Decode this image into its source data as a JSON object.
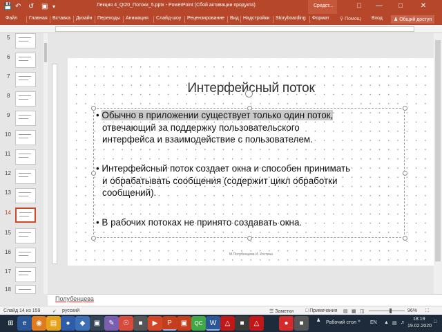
{
  "titlebar": {
    "title": "Лекция 4_Qt20_Потоки_5.pptx - PowerPoint (Сбой активации продукта)",
    "tools_tab": "Средст..."
  },
  "ribbon": {
    "tabs": [
      "Файл",
      "Главная",
      "Вставка",
      "Дизайн",
      "Переходы",
      "Анимация",
      "Слайд-шоу",
      "Рецензирование",
      "Вид",
      "Надстройки",
      "Storyboarding",
      "Формат"
    ],
    "tell_me": "Помощ",
    "signin": "Вход",
    "share": "Общий доступ"
  },
  "thumbnails": {
    "numbers": [
      "5",
      "6",
      "7",
      "8",
      "9",
      "10",
      "11",
      "12",
      "13",
      "14",
      "15",
      "16",
      "17",
      "18"
    ],
    "active": "14"
  },
  "slide": {
    "title": "Интерфейсный поток",
    "bullets": [
      {
        "lines": [
          "Обычно в приложении существует только один поток,",
          "отвечающий за поддержку пользовательского",
          "интерфейса и взаимодействие с пользователем."
        ]
      },
      {
        "lines": [
          "Интерфейсный поток создает окна и способен принимать",
          "и обрабатывать сообщения (содержит цикл обработки",
          "сообщений)."
        ]
      },
      {
        "lines": [
          "В рабочих потоках не принято создавать окна."
        ]
      }
    ],
    "footer": "М.Полубенцева И. Костина"
  },
  "notes": {
    "text": "Полубенцева"
  },
  "statusbar": {
    "slide_info": "Слайд 14 из 159",
    "language": "русский",
    "notes_btn": "Заметки",
    "comments_btn": "Примечания",
    "zoom": "96%"
  },
  "taskbar": {
    "desktop_label": "Рабочий стол",
    "lang": "EN",
    "time": "18:19",
    "date": "19.02.2020"
  },
  "colors": {
    "accent": "#b7472a",
    "active_thumb": "#d24726",
    "taskbar": "#1d2b3a"
  }
}
